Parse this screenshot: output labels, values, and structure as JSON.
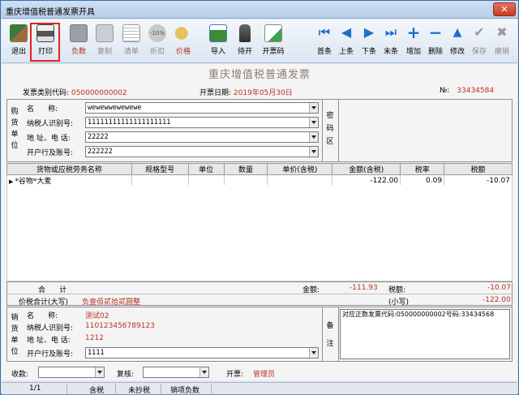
{
  "window": {
    "title": "重庆增值税普通发票开具",
    "close_label": "✕"
  },
  "toolbar": {
    "left": [
      {
        "label": "退出",
        "icon": "exit-icon"
      },
      {
        "label": "打印",
        "icon": "printer-icon"
      },
      {
        "label": "负数",
        "icon": "negative-icon"
      },
      {
        "label": "复制",
        "icon": "copy-icon"
      },
      {
        "label": "清单",
        "icon": "list-icon"
      },
      {
        "label": "折扣",
        "icon": "discount-icon",
        "badge": "-10%"
      },
      {
        "label": "价格",
        "icon": "price-icon"
      },
      {
        "label": "导入",
        "icon": "import-icon"
      },
      {
        "label": "待开",
        "icon": "pending-icon"
      },
      {
        "label": "开票码",
        "icon": "invoice-code-icon"
      }
    ],
    "right": [
      {
        "label": "首条",
        "icon": "first-record-icon"
      },
      {
        "label": "上条",
        "icon": "prev-record-icon"
      },
      {
        "label": "下条",
        "icon": "next-record-icon"
      },
      {
        "label": "末条",
        "icon": "last-record-icon"
      },
      {
        "label": "增加",
        "icon": "add-icon"
      },
      {
        "label": "删除",
        "icon": "delete-icon"
      },
      {
        "label": "修改",
        "icon": "edit-icon"
      },
      {
        "label": "保存",
        "icon": "save-icon"
      },
      {
        "label": "撤销",
        "icon": "undo-icon"
      }
    ]
  },
  "invoice": {
    "title": "重庆增值税普通发票",
    "type_code_label": "发票类别代码:",
    "type_code": "050000000002",
    "date_label": "开票日期:",
    "date": "2019年05月30日",
    "no_label": "№:",
    "no": "33434584"
  },
  "buyer": {
    "section_label": [
      "购",
      "货",
      "单",
      "位"
    ],
    "name_label": "名      称:",
    "name": "wewewwewewewe",
    "tax_id_label": "纳税人识别号:",
    "tax_id": "11111111111111111111",
    "address_label": "地 址、电 话:",
    "address": "22222",
    "bank_label": "开户行及账号:",
    "bank": "222222",
    "password_area_label": [
      "密",
      "码",
      "区"
    ]
  },
  "table": {
    "headers": [
      "货物或应税劳务名称",
      "规格型号",
      "单位",
      "数量",
      "单价(含税)",
      "金额(含税)",
      "税率",
      "税额"
    ],
    "rows": [
      {
        "name": "*谷物*大麦",
        "spec": "",
        "unit": "",
        "qty": "",
        "price": "",
        "amount": "-122.00",
        "rate": "0.09",
        "tax": "-10.07"
      }
    ]
  },
  "totals": {
    "sum_label": "合      计",
    "amount_label": "金额:",
    "amount": "-111.93",
    "tax_label": "税额:",
    "tax": "-10.07",
    "price_tax_label": "价税合计(大写)",
    "price_tax_upper": "负壹佰贰拾贰圆整",
    "small_label": "(小写)",
    "small_value": "-122.00"
  },
  "seller": {
    "section_label": [
      "销",
      "货",
      "单",
      "位"
    ],
    "name_label": "名      称:",
    "name": "测试02",
    "tax_id_label": "纳税人识别号:",
    "tax_id": "110123456789123",
    "address_label": "地 址、电 话:",
    "address": "1212",
    "bank_label": "开户行及账号:",
    "bank": "1111",
    "remark_label": [
      "备",
      "注"
    ],
    "remark": "对应正数发票代码:050000000002号码:33434568"
  },
  "footer": {
    "payee_label": "收款:",
    "reviewer_label": "复核:",
    "issuer_label": "开票:",
    "issuer": "管理员"
  },
  "status": {
    "page": "1/1",
    "tax_mode": "含税",
    "copy": "未抄税",
    "kind": "销项负数"
  },
  "colors": {
    "accent_red": "#b4331f",
    "highlight": "#e0251b"
  }
}
